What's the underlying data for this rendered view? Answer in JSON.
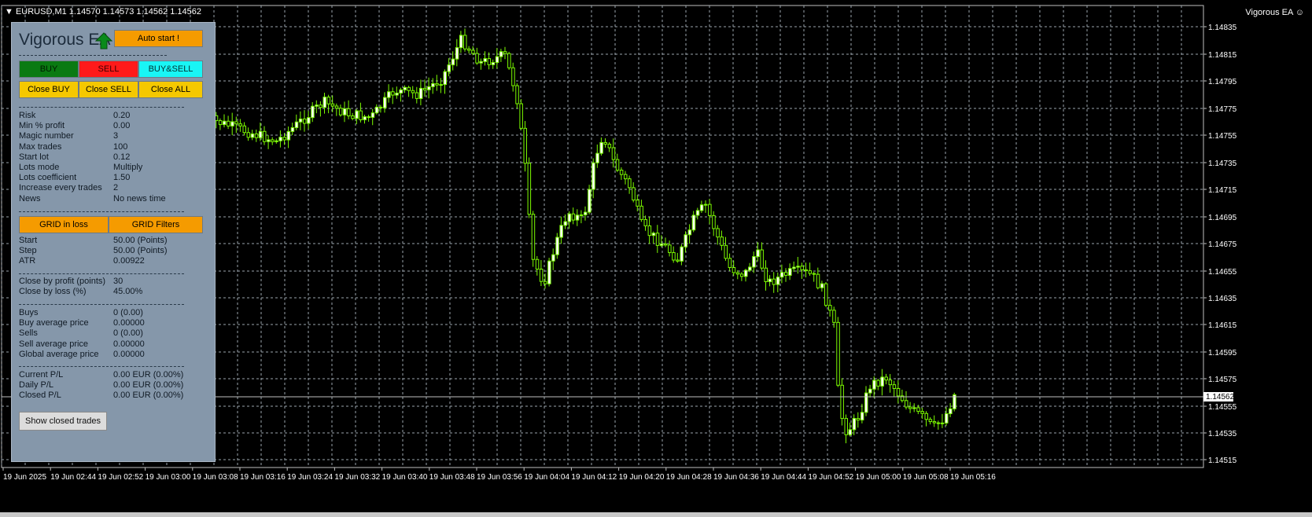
{
  "window": {
    "symbol_info": "EURUSD,M1  1.14570 1.14573 1.14562 1.14562",
    "ea_label": "Vigorous EA ☺",
    "current_price": "1.14562"
  },
  "panel": {
    "title": "Vigorous EA",
    "auto_start": "Auto start !",
    "buy": "BUY",
    "sell": "SELL",
    "buy_sell": "BUY&SELL",
    "close_buy": "Close BUY",
    "close_sell": "Close SELL",
    "close_all": "Close ALL",
    "grid_in_loss": "GRID in loss",
    "grid_filters": "GRID Filters",
    "show_closed_trades": "Show closed trades",
    "params": [
      {
        "k": "Risk",
        "v": "0.20"
      },
      {
        "k": "Min % profit",
        "v": "0.00"
      },
      {
        "k": "Magic number",
        "v": "3"
      },
      {
        "k": "Max trades",
        "v": "100"
      },
      {
        "k": "Start lot",
        "v": "0.12"
      },
      {
        "k": "Lots mode",
        "v": "Multiply"
      },
      {
        "k": "Lots coefficient",
        "v": "1.50"
      },
      {
        "k": "Increase every trades",
        "v": "2"
      },
      {
        "k": "News",
        "v": "No news time"
      }
    ],
    "grid": [
      {
        "k": "Start",
        "v": "50.00 (Points)"
      },
      {
        "k": "Step",
        "v": "50.00 (Points)"
      },
      {
        "k": "ATR",
        "v": "0.00922"
      }
    ],
    "close": [
      {
        "k": "Close by profit (points)",
        "v": "30"
      },
      {
        "k": "Close by loss (%)",
        "v": "45.00%"
      }
    ],
    "positions": [
      {
        "k": "Buys",
        "v": "0 (0.00)"
      },
      {
        "k": "Buy average price",
        "v": "0.00000"
      },
      {
        "k": "Sells",
        "v": "0 (0.00)"
      },
      {
        "k": "Sell average price",
        "v": "0.00000"
      },
      {
        "k": "Global average price",
        "v": "0.00000"
      }
    ],
    "pl": [
      {
        "k": "Current P/L",
        "v": "0.00 EUR (0.00%)"
      },
      {
        "k": "Daily P/L",
        "v": "0.00 EUR (0.00%)"
      },
      {
        "k": "Closed P/L",
        "v": "0.00 EUR (0.00%)"
      }
    ]
  },
  "price_axis": [
    "1.14835",
    "1.14815",
    "1.14795",
    "1.14775",
    "1.14755",
    "1.14735",
    "1.14715",
    "1.14695",
    "1.14675",
    "1.14655",
    "1.14635",
    "1.14615",
    "1.14595",
    "1.14575",
    "1.14555",
    "1.14535",
    "1.14515"
  ],
  "time_axis": [
    "19 Jun 2025",
    "19 Jun 02:44",
    "19 Jun 02:52",
    "19 Jun 03:00",
    "19 Jun 03:08",
    "19 Jun 03:16",
    "19 Jun 03:24",
    "19 Jun 03:32",
    "19 Jun 03:40",
    "19 Jun 03:48",
    "19 Jun 03:56",
    "19 Jun 04:04",
    "19 Jun 04:12",
    "19 Jun 04:20",
    "19 Jun 04:28",
    "19 Jun 04:36",
    "19 Jun 04:44",
    "19 Jun 04:52",
    "19 Jun 05:00",
    "19 Jun 05:08",
    "19 Jun 05:16"
  ],
  "colors": {
    "background": "#000000",
    "grid": "#9aa4ad",
    "candle": "#7cfc00",
    "panel": "#8597aa",
    "buy": "#0a7a12",
    "sell": "#ff1a1a",
    "buy_sell": "#19f5f5",
    "close": "#f5c800",
    "orange": "#f59b00"
  }
}
